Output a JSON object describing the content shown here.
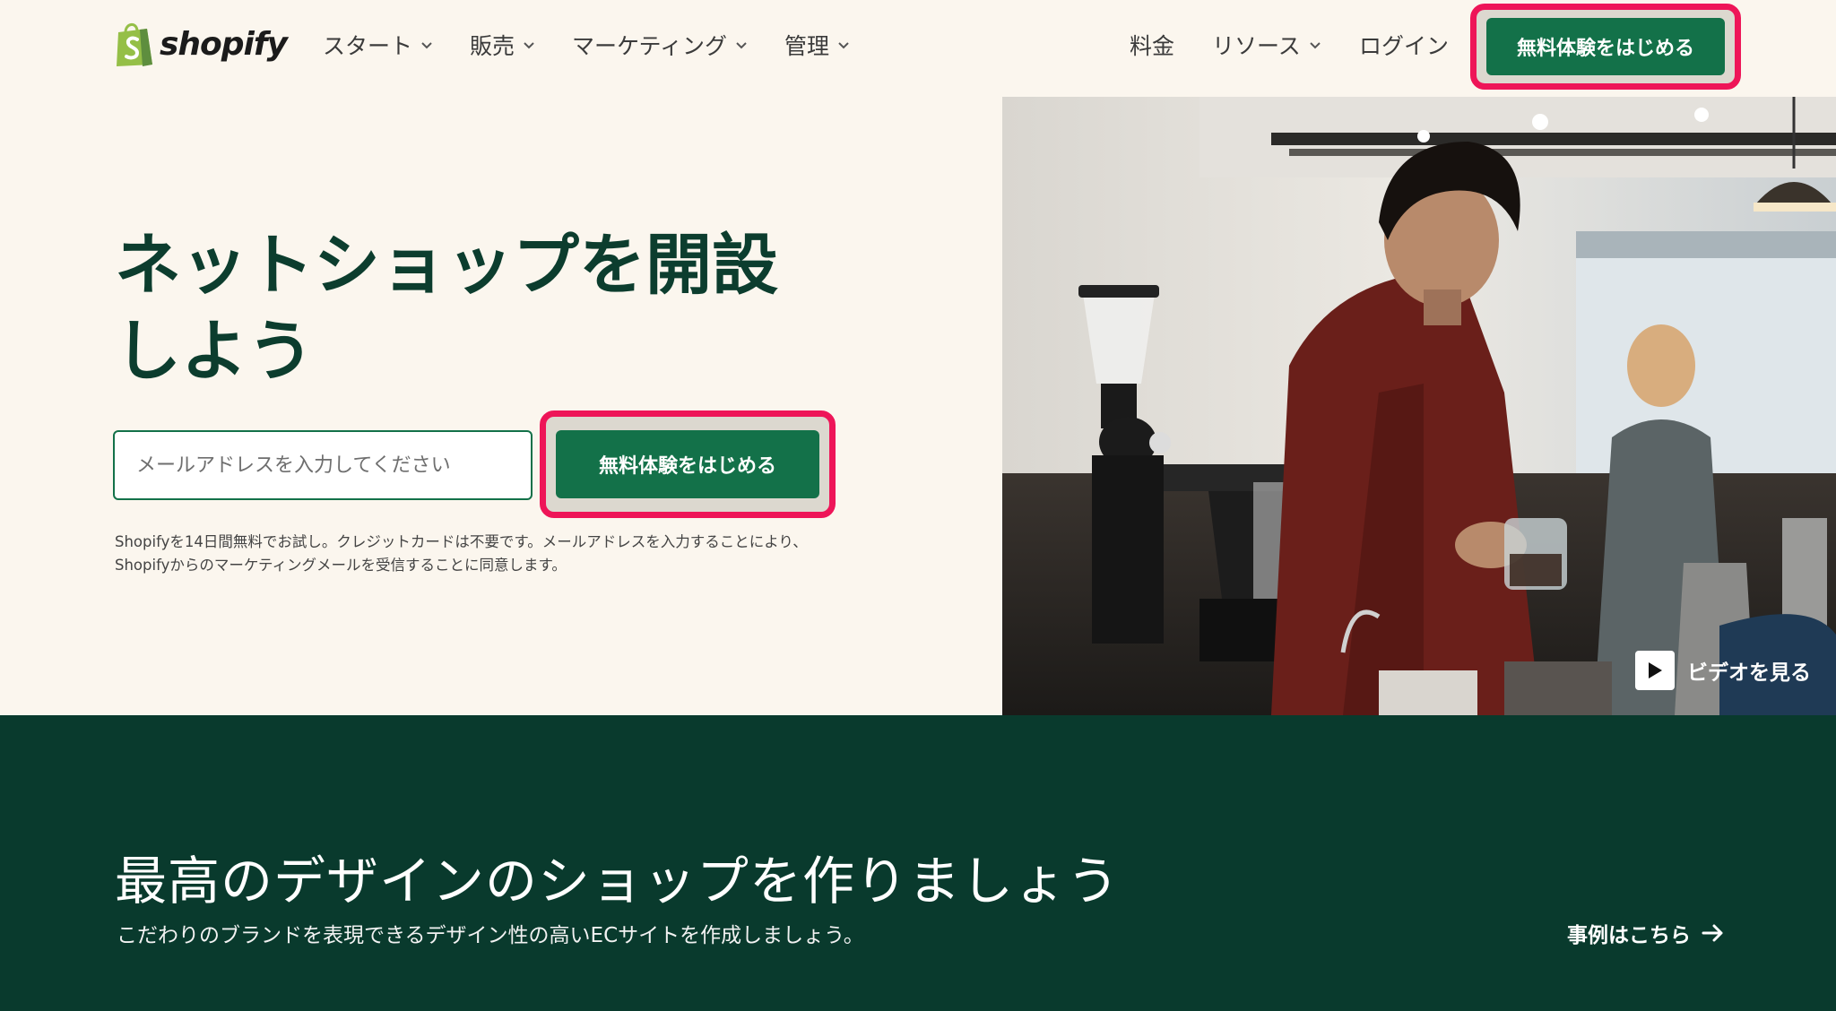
{
  "header": {
    "logo_text": "shopify",
    "nav_left": [
      {
        "label": "スタート",
        "has_dropdown": true
      },
      {
        "label": "販売",
        "has_dropdown": true
      },
      {
        "label": "マーケティング",
        "has_dropdown": true
      },
      {
        "label": "管理",
        "has_dropdown": true
      }
    ],
    "pricing_label": "料金",
    "resources_label": "リソース",
    "login_label": "ログイン",
    "cta_label": "無料体験をはじめる"
  },
  "hero": {
    "title": "ネットショップを開設しよう",
    "email_placeholder": "メールアドレスを入力してください",
    "cta_label": "無料体験をはじめる",
    "disclaimer": "Shopifyを14日間無料でお試し。クレジットカードは不要です。メールアドレスを入力することにより、Shopifyからのマーケティングメールを受信することに同意します。",
    "video_label": "ビデオを見る"
  },
  "design_section": {
    "title": "最高のデザインのショップを作りましょう",
    "subtitle": "こだわりのブランドを表現できるデザイン性の高いECサイトを作成しましょう。",
    "link_label": "事例はこちら"
  },
  "colors": {
    "brand_green": "#137149",
    "dark_green": "#093a2d",
    "title_green": "#0c3d2e",
    "cream": "#fbf6ee",
    "highlight": "#ee1558",
    "logo_green": "#95bf47"
  }
}
